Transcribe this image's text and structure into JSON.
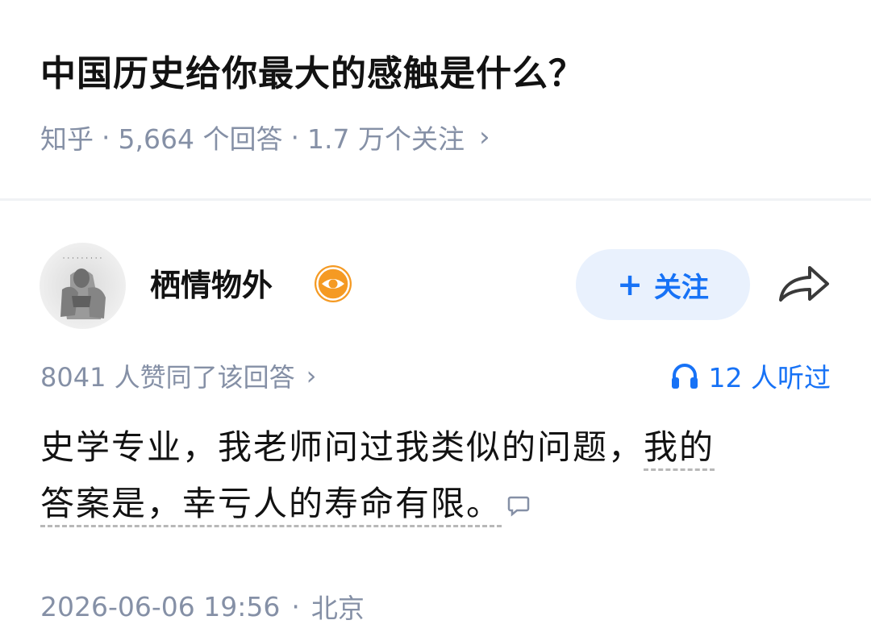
{
  "question": {
    "title": "中国历史给你最大的感触是什么？",
    "source": "知乎",
    "answer_count": "5,664 个回答",
    "follow_count": "1.7 万个关注"
  },
  "answer": {
    "author_name": "栖情物外",
    "follow_button": "关注",
    "voteup_text": "8041 人赞同了该回答",
    "listen_text": "12 人听过",
    "content_plain": "史学专业，我老师问过我类似的问题，",
    "content_highlight_1": "我的",
    "content_highlight_2": "答案是，幸亏人的寿命有限。",
    "date": "2026-06-06 19:56",
    "location": "北京"
  },
  "icons": {
    "chevron": "chevron-right-icon",
    "badge": "eye-badge-icon",
    "share": "share-arrow-icon",
    "listen": "headphones-icon",
    "comment": "comment-bubble-icon"
  },
  "colors": {
    "accent": "#1772f6",
    "follow_bg": "#e9f1fd",
    "meta": "#8590a6",
    "badge": "#f59a23"
  }
}
